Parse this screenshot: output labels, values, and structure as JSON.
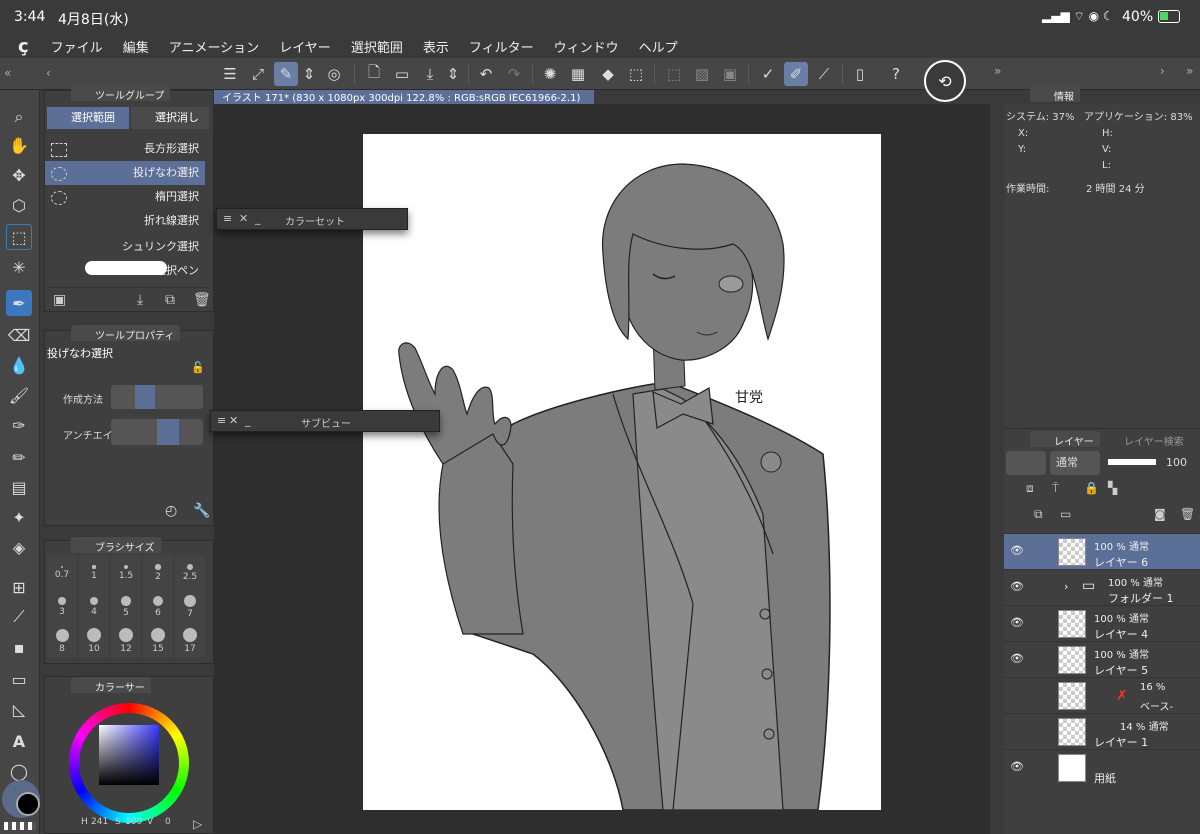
{
  "status": {
    "time": "3:44",
    "date": "4月8日(水)",
    "battery": "40%"
  },
  "menu": [
    "ファイル",
    "編集",
    "アニメーション",
    "レイヤー",
    "選択範囲",
    "表示",
    "フィルター",
    "ウィンドウ",
    "ヘルプ"
  ],
  "doc_tab": "イラスト 171* (830 x 1080px 300dpi 122.8% : RGB:sRGB IEC61966-2.1)",
  "tool_group": {
    "title": "ツールグループ",
    "tabs": [
      "選択範囲",
      "選択消し"
    ],
    "items": [
      "長方形選択",
      "投げなわ選択",
      "楕円選択",
      "折れ線選択",
      "シュリンク選択",
      "選択ペン"
    ],
    "selected_index": 1
  },
  "tool_property": {
    "title": "ツールプロパティ",
    "tool_name": "投げなわ選択",
    "labels": [
      "作成方法",
      "アンチエイリ"
    ]
  },
  "brush_size": {
    "title": "ブラシサイズ",
    "values": [
      "0.7",
      "1",
      "1.5",
      "2",
      "2.5",
      "3",
      "4",
      "5",
      "6",
      "7",
      "8",
      "10",
      "12",
      "15",
      "17"
    ]
  },
  "color_panel": {
    "title": "カラーサー",
    "h": "241",
    "s": "100",
    "v": "0",
    "h_label": "H",
    "s_label": "S",
    "v_label": "V"
  },
  "float_panels": {
    "color_set": "カラーセット",
    "sub_view": "サブビュー"
  },
  "info": {
    "tab": "情報",
    "system": "システム: 37%",
    "app": "アプリケーション: 83%",
    "x_label": "X:",
    "y_label": "Y:",
    "h_label": "H:",
    "v_label": "V:",
    "l_label": "L:",
    "work_time_label": "作業時間:",
    "work_time": "2 時間 24 分"
  },
  "layer_panel": {
    "tabs": [
      "レイヤー",
      "レイヤー検索"
    ],
    "blend": "通常",
    "opacity": "100",
    "layers": [
      {
        "opacity": "100 % 通常",
        "name": "レイヤー 6"
      },
      {
        "opacity": "100 % 通常",
        "name": "フォルダー 1"
      },
      {
        "opacity": "100 % 通常",
        "name": "レイヤー 4"
      },
      {
        "opacity": "100 % 通常",
        "name": "レイヤー 5"
      },
      {
        "opacity": "16 %",
        "name": "ベース-"
      },
      {
        "opacity": "14 % 通常",
        "name": "レイヤー 1"
      },
      {
        "opacity": "",
        "name": "用紙"
      }
    ]
  },
  "canvas": {
    "signature": "甘党"
  }
}
